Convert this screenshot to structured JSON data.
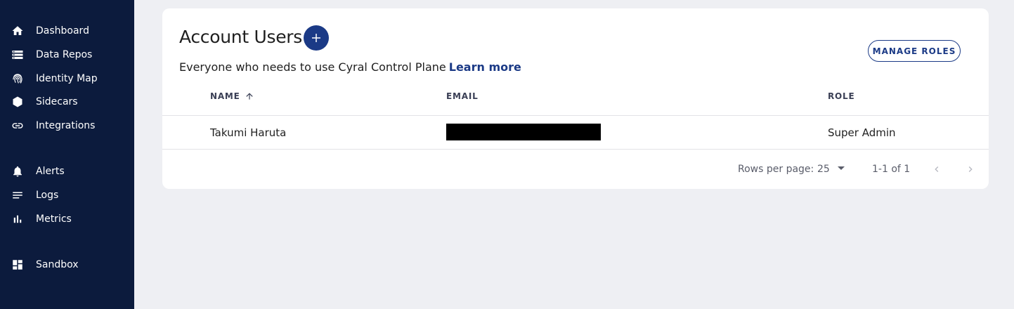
{
  "sidebar": {
    "items": [
      {
        "label": "Dashboard",
        "icon": "home-icon"
      },
      {
        "label": "Data Repos",
        "icon": "storage-icon"
      },
      {
        "label": "Identity Map",
        "icon": "fingerprint-icon"
      },
      {
        "label": "Sidecars",
        "icon": "hexagon-icon"
      },
      {
        "label": "Integrations",
        "icon": "link-icon"
      },
      {
        "label": "Alerts",
        "icon": "bell-icon"
      },
      {
        "label": "Logs",
        "icon": "lines-icon"
      },
      {
        "label": "Metrics",
        "icon": "bar-chart-icon"
      },
      {
        "label": "Sandbox",
        "icon": "dashboard-grid-icon"
      }
    ]
  },
  "main": {
    "title": "Account Users",
    "subtitle": "Everyone who needs to use Cyral Control Plane",
    "learn_more": "Learn more",
    "manage_roles": "MANAGE ROLES",
    "table": {
      "columns": [
        "NAME",
        "EMAIL",
        "ROLE"
      ],
      "rows": [
        {
          "name": "Takumi Haruta",
          "email": "",
          "role": "Super Admin"
        }
      ]
    },
    "pagination": {
      "rows_per_page_label": "Rows per page:",
      "rows_per_page": "25",
      "range": "1-1 of 1"
    }
  },
  "colors": {
    "sidebar_bg": "#0c1b3d",
    "accent": "#1b3a86",
    "page_bg": "#eeeff3"
  }
}
